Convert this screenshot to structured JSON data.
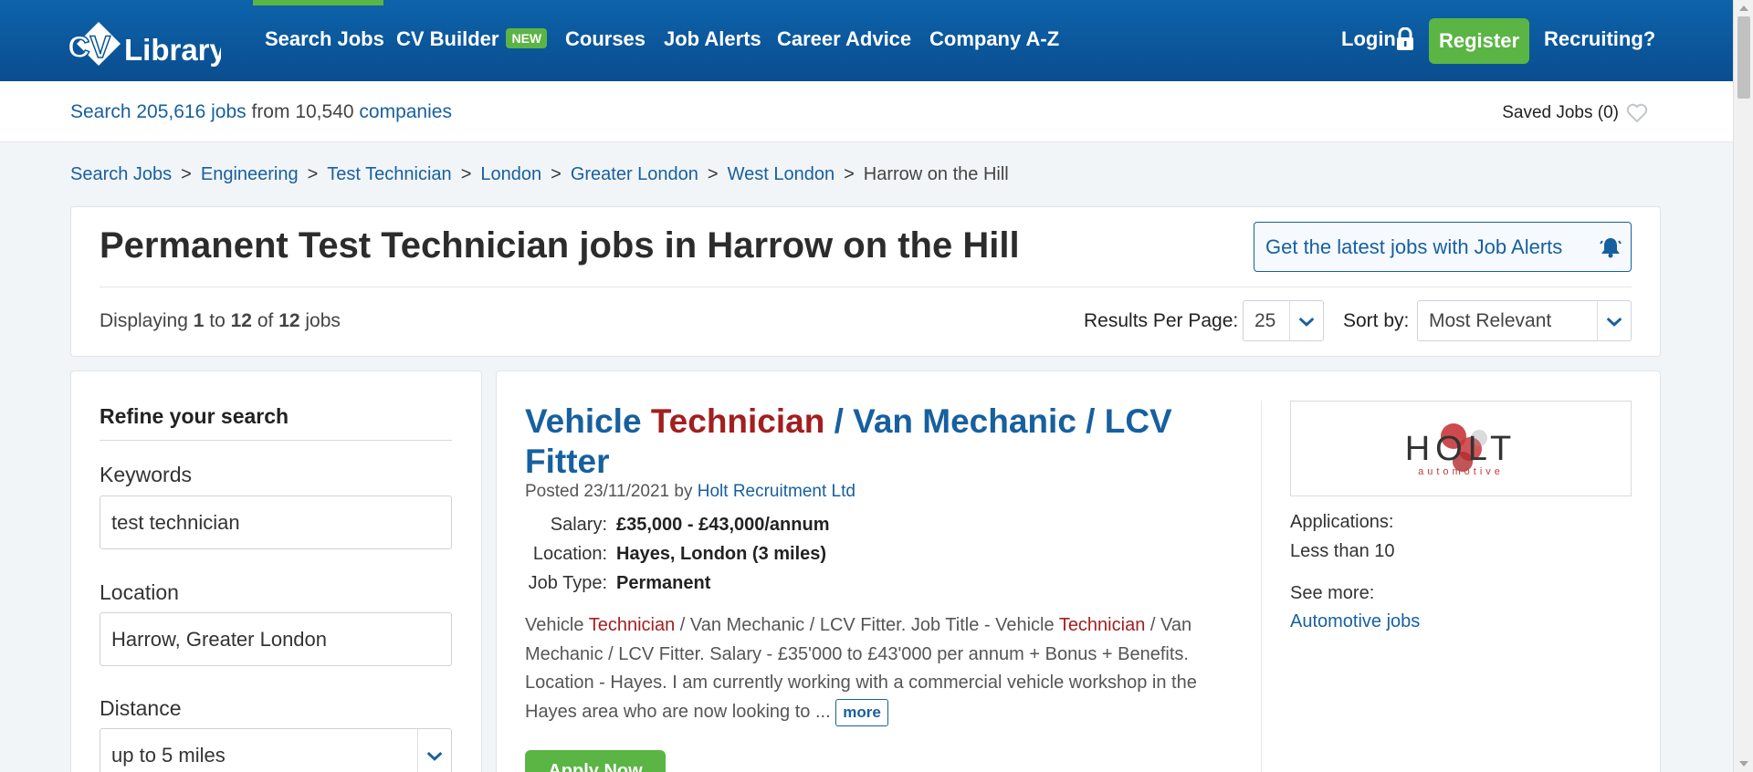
{
  "nav": {
    "logo_text": "CV Library",
    "items": [
      "Search Jobs",
      "CV Builder",
      "Courses",
      "Job Alerts",
      "Career Advice",
      "Company A-Z"
    ],
    "new_badge": "NEW",
    "login": "Login",
    "register": "Register",
    "recruiting": "Recruiting?",
    "brand_blue": "#0d63ab",
    "accent_green": "#5bb544"
  },
  "subbar": {
    "search_prefix": "Search 205,616 jobs",
    "from_word": "from 10,540",
    "companies": "companies",
    "saved_jobs": "Saved Jobs (0)"
  },
  "breadcrumb": [
    "Search Jobs",
    "Engineering",
    "Test Technician",
    "London",
    "Greater London",
    "West London",
    "Harrow on the Hill"
  ],
  "header": {
    "title": "Permanent Test Technician jobs in Harrow on the Hill",
    "job_alerts_button": "Get the latest jobs with Job Alerts",
    "displaying_prefix": "Displaying",
    "range_from": "1",
    "to_word": "to",
    "range_to": "12",
    "of_word": "of",
    "total": "12",
    "jobs_word": "jobs",
    "results_per_page_label": "Results Per Page:",
    "results_per_page_value": "25",
    "sort_label": "Sort by:",
    "sort_value": "Most Relevant"
  },
  "sidebar": {
    "heading": "Refine your search",
    "keywords_label": "Keywords",
    "keywords_value": "test technician",
    "location_label": "Location",
    "location_value": "Harrow, Greater London",
    "distance_label": "Distance",
    "distance_value": "up to 5 miles"
  },
  "job": {
    "title_part1": "Vehicle",
    "title_highlight": "Technician",
    "title_part2": "/ Van Mechanic / LCV Fitter",
    "posted_prefix": "Posted 23/11/2021 by",
    "recruiter": "Holt Recruitment Ltd",
    "salary_label": "Salary:",
    "salary_value": "£35,000 - £43,000/annum",
    "location_label": "Location:",
    "location_value": "Hayes, London (3 miles)",
    "type_label": "Job Type:",
    "type_value": "Permanent",
    "snippet_1": "Vehicle",
    "snippet_hl_1": "Technician",
    "snippet_2": "/ Van Mechanic / LCV Fitter. Job Title - Vehicle",
    "snippet_hl_2": "Technician",
    "snippet_3": "/ Van Mechanic / LCV Fitter. Salary - £35'000 to £43'000 per annum + Bonus + Benefits. Location - Hayes. I am currently working with a commercial vehicle workshop in the Hayes area who are now looking to ...",
    "more_label": "more",
    "apply_label": "Apply Now",
    "company_logo_text": "HOLT",
    "company_logo_sub": "automotive",
    "applications_label": "Applications:",
    "applications_value": "Less than 10",
    "see_more_label": "See more:",
    "see_more_link": "Automotive jobs"
  }
}
